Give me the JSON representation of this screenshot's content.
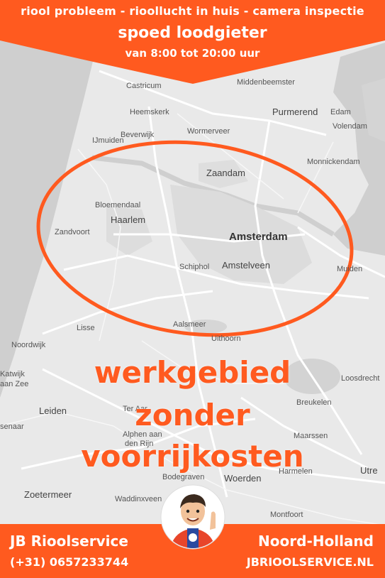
{
  "header": {
    "tagline": "riool probleem - rioollucht in huis - camera inspectie",
    "headline": "spoed loodgieter",
    "hours": "van 8:00 tot 20:00 uur"
  },
  "places": {
    "castricum": "Castricum",
    "middenbeemster": "Middenbeemster",
    "heemskerk": "Heemskerk",
    "purmerend": "Purmerend",
    "edam": "Edam",
    "beverwijk": "Beverwijk",
    "wormerveer": "Wormerveer",
    "volendam": "Volendam",
    "ijmuiden": "IJmuiden",
    "zaandam": "Zaandam",
    "monnickendam": "Monnickendam",
    "bloemendaal": "Bloemendaal",
    "haarlem": "Haarlem",
    "zandvoort": "Zandvoort",
    "amsterdam": "Amsterdam",
    "muiden": "Muiden",
    "schiphol": "Schiphol",
    "amstelveen": "Amstelveen",
    "lisse": "Lisse",
    "aalsmeer": "Aalsmeer",
    "uithoorn": "Uithoorn",
    "noordwijk": "Noordwijk",
    "katwijk": "Katwijk",
    "aan_zee": "aan Zee",
    "loosdrecht": "Loosdrecht",
    "leiden": "Leiden",
    "breukelen": "Breukelen",
    "senaar": "senaar",
    "alphen1": "Alphen aan",
    "alphen2": "den Rijn",
    "maarssen": "Maarssen",
    "bodegraven": "Bodegraven",
    "harmelen": "Harmelen",
    "woerden": "Woerden",
    "utrecht": "Utre",
    "zoetermeer": "Zoetermeer",
    "waddinxveen": "Waddinxveen",
    "montfoort": "Montfoort",
    "ter_aar": "Ter Aar"
  },
  "promo": {
    "line1": "werkgebied",
    "line2": "zonder",
    "line3": "voorrijkosten"
  },
  "footer": {
    "company": "JB Rioolservice",
    "phone": "(+31) 0657233744",
    "region": "Noord-Holland",
    "website": "JBRIOOLSERVICE.NL"
  },
  "colors": {
    "brand_orange": "#ff5a1f",
    "map_land": "#e7e7e7",
    "map_water": "#c9c9c9",
    "road": "#ffffff"
  }
}
